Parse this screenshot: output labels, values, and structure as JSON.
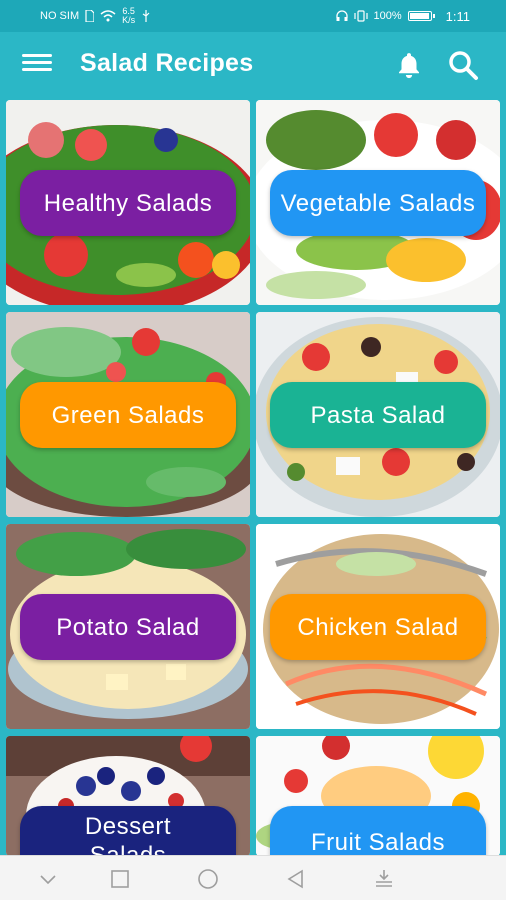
{
  "status_bar": {
    "carrier": "NO SIM",
    "speed_top": "6.5",
    "speed_bottom": "K/s",
    "battery_percent": "100%",
    "battery_level": 1.0,
    "time": "1:11"
  },
  "app_bar": {
    "title": "Salad Recipes",
    "menu_icon": "hamburger-menu-icon",
    "notification_icon": "bell-icon",
    "search_icon": "search-icon"
  },
  "categories": [
    {
      "label": "Healthy Salads",
      "color": "#7b1fa2",
      "icon": "strawberry-salad-photo"
    },
    {
      "label": "Vegetable Salads",
      "color": "#2196f3",
      "icon": "cucumber-salad-photo"
    },
    {
      "label": "Green Salads",
      "color": "#ff9800",
      "icon": "green-salad-bowl-photo"
    },
    {
      "label": "Pasta Salad",
      "color": "#1ab394",
      "icon": "pasta-salad-photo"
    },
    {
      "label": "Potato Salad",
      "color": "#7b1fa2",
      "icon": "potato-salad-photo"
    },
    {
      "label": "Chicken Salad",
      "color": "#ff9800",
      "icon": "chicken-slaw-photo"
    },
    {
      "label": "Dessert Salads",
      "color": "#1a237e",
      "icon": "berry-dessert-photo"
    },
    {
      "label": "Fruit Salads",
      "color": "#2196f3",
      "icon": "fruit-salad-photo"
    }
  ],
  "nav_bar": {
    "icons": [
      "chevron-down-icon",
      "square-recents-icon",
      "circle-home-icon",
      "triangle-back-icon",
      "download-tray-icon"
    ]
  }
}
